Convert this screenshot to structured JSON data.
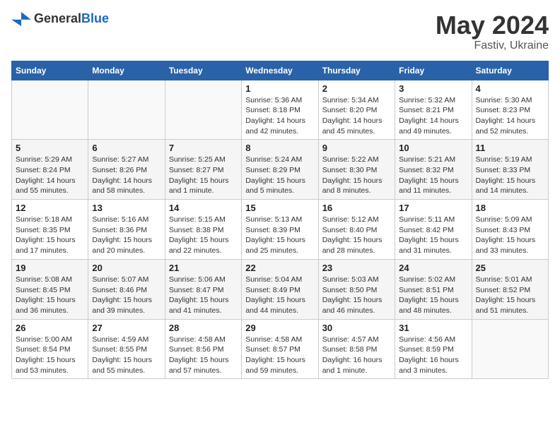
{
  "header": {
    "logo_general": "General",
    "logo_blue": "Blue",
    "title": "May 2024",
    "subtitle": "Fastiv, Ukraine"
  },
  "weekdays": [
    "Sunday",
    "Monday",
    "Tuesday",
    "Wednesday",
    "Thursday",
    "Friday",
    "Saturday"
  ],
  "weeks": [
    [
      {
        "day": "",
        "sunrise": "",
        "sunset": "",
        "daylight": ""
      },
      {
        "day": "",
        "sunrise": "",
        "sunset": "",
        "daylight": ""
      },
      {
        "day": "",
        "sunrise": "",
        "sunset": "",
        "daylight": ""
      },
      {
        "day": "1",
        "sunrise": "Sunrise: 5:36 AM",
        "sunset": "Sunset: 8:18 PM",
        "daylight": "Daylight: 14 hours and 42 minutes."
      },
      {
        "day": "2",
        "sunrise": "Sunrise: 5:34 AM",
        "sunset": "Sunset: 8:20 PM",
        "daylight": "Daylight: 14 hours and 45 minutes."
      },
      {
        "day": "3",
        "sunrise": "Sunrise: 5:32 AM",
        "sunset": "Sunset: 8:21 PM",
        "daylight": "Daylight: 14 hours and 49 minutes."
      },
      {
        "day": "4",
        "sunrise": "Sunrise: 5:30 AM",
        "sunset": "Sunset: 8:23 PM",
        "daylight": "Daylight: 14 hours and 52 minutes."
      }
    ],
    [
      {
        "day": "5",
        "sunrise": "Sunrise: 5:29 AM",
        "sunset": "Sunset: 8:24 PM",
        "daylight": "Daylight: 14 hours and 55 minutes."
      },
      {
        "day": "6",
        "sunrise": "Sunrise: 5:27 AM",
        "sunset": "Sunset: 8:26 PM",
        "daylight": "Daylight: 14 hours and 58 minutes."
      },
      {
        "day": "7",
        "sunrise": "Sunrise: 5:25 AM",
        "sunset": "Sunset: 8:27 PM",
        "daylight": "Daylight: 15 hours and 1 minute."
      },
      {
        "day": "8",
        "sunrise": "Sunrise: 5:24 AM",
        "sunset": "Sunset: 8:29 PM",
        "daylight": "Daylight: 15 hours and 5 minutes."
      },
      {
        "day": "9",
        "sunrise": "Sunrise: 5:22 AM",
        "sunset": "Sunset: 8:30 PM",
        "daylight": "Daylight: 15 hours and 8 minutes."
      },
      {
        "day": "10",
        "sunrise": "Sunrise: 5:21 AM",
        "sunset": "Sunset: 8:32 PM",
        "daylight": "Daylight: 15 hours and 11 minutes."
      },
      {
        "day": "11",
        "sunrise": "Sunrise: 5:19 AM",
        "sunset": "Sunset: 8:33 PM",
        "daylight": "Daylight: 15 hours and 14 minutes."
      }
    ],
    [
      {
        "day": "12",
        "sunrise": "Sunrise: 5:18 AM",
        "sunset": "Sunset: 8:35 PM",
        "daylight": "Daylight: 15 hours and 17 minutes."
      },
      {
        "day": "13",
        "sunrise": "Sunrise: 5:16 AM",
        "sunset": "Sunset: 8:36 PM",
        "daylight": "Daylight: 15 hours and 20 minutes."
      },
      {
        "day": "14",
        "sunrise": "Sunrise: 5:15 AM",
        "sunset": "Sunset: 8:38 PM",
        "daylight": "Daylight: 15 hours and 22 minutes."
      },
      {
        "day": "15",
        "sunrise": "Sunrise: 5:13 AM",
        "sunset": "Sunset: 8:39 PM",
        "daylight": "Daylight: 15 hours and 25 minutes."
      },
      {
        "day": "16",
        "sunrise": "Sunrise: 5:12 AM",
        "sunset": "Sunset: 8:40 PM",
        "daylight": "Daylight: 15 hours and 28 minutes."
      },
      {
        "day": "17",
        "sunrise": "Sunrise: 5:11 AM",
        "sunset": "Sunset: 8:42 PM",
        "daylight": "Daylight: 15 hours and 31 minutes."
      },
      {
        "day": "18",
        "sunrise": "Sunrise: 5:09 AM",
        "sunset": "Sunset: 8:43 PM",
        "daylight": "Daylight: 15 hours and 33 minutes."
      }
    ],
    [
      {
        "day": "19",
        "sunrise": "Sunrise: 5:08 AM",
        "sunset": "Sunset: 8:45 PM",
        "daylight": "Daylight: 15 hours and 36 minutes."
      },
      {
        "day": "20",
        "sunrise": "Sunrise: 5:07 AM",
        "sunset": "Sunset: 8:46 PM",
        "daylight": "Daylight: 15 hours and 39 minutes."
      },
      {
        "day": "21",
        "sunrise": "Sunrise: 5:06 AM",
        "sunset": "Sunset: 8:47 PM",
        "daylight": "Daylight: 15 hours and 41 minutes."
      },
      {
        "day": "22",
        "sunrise": "Sunrise: 5:04 AM",
        "sunset": "Sunset: 8:49 PM",
        "daylight": "Daylight: 15 hours and 44 minutes."
      },
      {
        "day": "23",
        "sunrise": "Sunrise: 5:03 AM",
        "sunset": "Sunset: 8:50 PM",
        "daylight": "Daylight: 15 hours and 46 minutes."
      },
      {
        "day": "24",
        "sunrise": "Sunrise: 5:02 AM",
        "sunset": "Sunset: 8:51 PM",
        "daylight": "Daylight: 15 hours and 48 minutes."
      },
      {
        "day": "25",
        "sunrise": "Sunrise: 5:01 AM",
        "sunset": "Sunset: 8:52 PM",
        "daylight": "Daylight: 15 hours and 51 minutes."
      }
    ],
    [
      {
        "day": "26",
        "sunrise": "Sunrise: 5:00 AM",
        "sunset": "Sunset: 8:54 PM",
        "daylight": "Daylight: 15 hours and 53 minutes."
      },
      {
        "day": "27",
        "sunrise": "Sunrise: 4:59 AM",
        "sunset": "Sunset: 8:55 PM",
        "daylight": "Daylight: 15 hours and 55 minutes."
      },
      {
        "day": "28",
        "sunrise": "Sunrise: 4:58 AM",
        "sunset": "Sunset: 8:56 PM",
        "daylight": "Daylight: 15 hours and 57 minutes."
      },
      {
        "day": "29",
        "sunrise": "Sunrise: 4:58 AM",
        "sunset": "Sunset: 8:57 PM",
        "daylight": "Daylight: 15 hours and 59 minutes."
      },
      {
        "day": "30",
        "sunrise": "Sunrise: 4:57 AM",
        "sunset": "Sunset: 8:58 PM",
        "daylight": "Daylight: 16 hours and 1 minute."
      },
      {
        "day": "31",
        "sunrise": "Sunrise: 4:56 AM",
        "sunset": "Sunset: 8:59 PM",
        "daylight": "Daylight: 16 hours and 3 minutes."
      },
      {
        "day": "",
        "sunrise": "",
        "sunset": "",
        "daylight": ""
      }
    ]
  ]
}
